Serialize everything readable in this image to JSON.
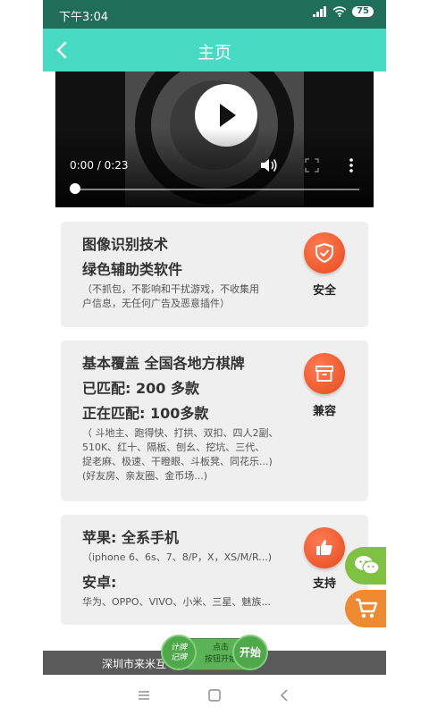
{
  "status": {
    "time": "下午3:04",
    "battery": "75"
  },
  "header": {
    "title": "主页"
  },
  "video": {
    "time": "0:00 / 0:23",
    "progress": 0
  },
  "cards": [
    {
      "lines_strong": [
        "图像识别技术",
        "绿色辅助类软件"
      ],
      "lines_small": [
        "（不抓包，不影响和干扰游戏，不收集用",
        "户信息，无任何广告及恶意插件）"
      ],
      "badge_icon": "shield-check-icon",
      "badge_label": "安全"
    },
    {
      "lines_strong": [
        "基本覆盖 全国各地方棋牌",
        "已匹配: 200 多款",
        "正在匹配: 100多款"
      ],
      "lines_small": [
        "（ 斗地主、跑得快、打拱、双扣、四人2副、",
        "510K、红十、隔板、刨幺、挖坑、三代、",
        "捉老麻、极速、干瞪眼、斗板凳、同花乐...)",
        "(好友房、亲友圈、金币场...)"
      ],
      "badge_icon": "box-icon",
      "badge_label": "兼容"
    },
    {
      "lines_strong": [
        "苹果: 全系手机",
        "安卓:"
      ],
      "lines_small": [
        "（iphone 6、6s、7、8/P，X，XS/M/R...)",
        "华为、OPPO、VIVO、小米、三星、魅族..."
      ],
      "badge_icon": "thumbs-up-icon",
      "badge_label": "支持"
    }
  ],
  "footer": {
    "text": "深圳市来米互                       18066343号-2"
  },
  "overlay": {
    "left": "计牌\n记牌",
    "middle": "点击\n按钮开始",
    "right": "开始"
  },
  "colors": {
    "statusbar": "#1f6e59",
    "header": "#47dbc3",
    "badge": "#ee5a2a",
    "wechat": "#7fc142",
    "cart": "#f08a32"
  }
}
